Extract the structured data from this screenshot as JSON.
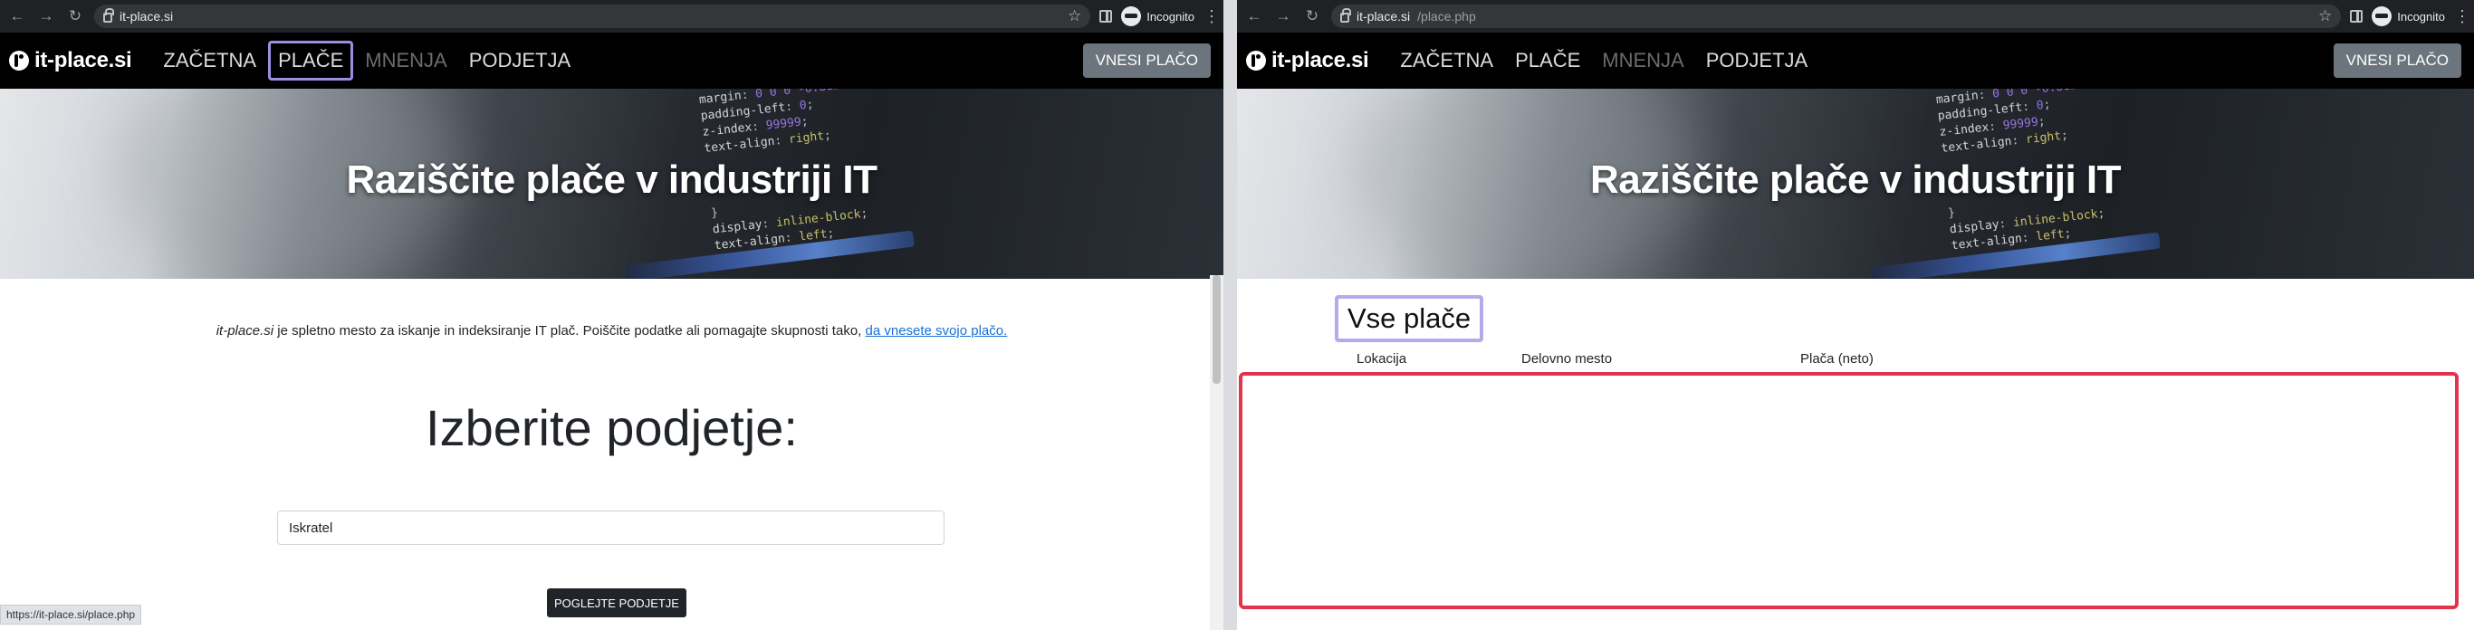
{
  "left": {
    "chrome": {
      "url_host": "it-place.si",
      "url_path": "",
      "profile_label": "Incognito"
    },
    "nav": {
      "brand": "it-place.si",
      "links": [
        "ZAČETNA",
        "PLAČE",
        "MNENJA",
        "PODJETJA"
      ],
      "cta": "VNESI PLAČO"
    },
    "hero_title": "Raziščite plače v industriji IT",
    "intro": {
      "site": "it-place.si",
      "text": " je spletno mesto za iskanje in indeksiranje IT plač. Poiščite podatke ali pomagajte skupnosti tako, ",
      "link": "da vnesete svojo plačo."
    },
    "choose_heading": "Izberite podjetje:",
    "company_input_value": "Iskratel",
    "view_button": "POGLEJTE PODJETJE",
    "status_url": "https://it-place.si/place.php"
  },
  "right": {
    "chrome": {
      "url_host": "it-place.si",
      "url_path": "/place.php",
      "profile_label": "Incognito"
    },
    "nav": {
      "brand": "it-place.si",
      "links": [
        "ZAČETNA",
        "PLAČE",
        "MNENJA",
        "PODJETJA"
      ],
      "cta": "VNESI PLAČO"
    },
    "hero_title": "Raziščite plače v industriji IT",
    "section_title": "Vse plače",
    "table_headers": [
      "Lokacija",
      "Delovno mesto",
      "Plača (neto)"
    ]
  },
  "colors": {
    "highlight_purple": "#9b8ee0",
    "highlight_red": "#e2334f",
    "link_blue": "#1a6fd6"
  }
}
